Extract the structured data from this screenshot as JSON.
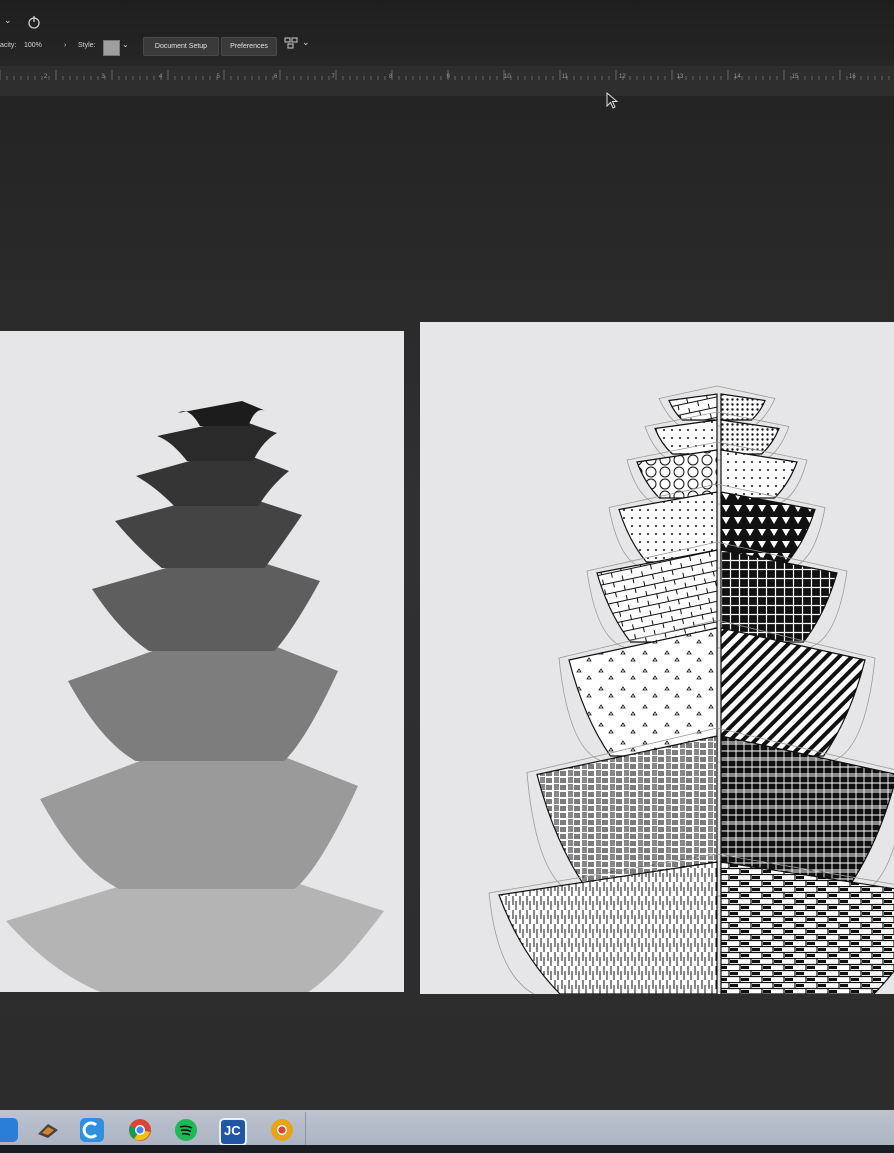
{
  "control_bar": {
    "opacity_label": "acity:",
    "opacity_value": "100%",
    "style_label": "Style:",
    "document_setup_label": "Document Setup",
    "preferences_label": "Preferences"
  },
  "ruler": {
    "labels": [
      "2",
      "3",
      "4",
      "5",
      "6",
      "7",
      "8",
      "9",
      "10",
      "11",
      "12",
      "13",
      "14",
      "15",
      "16"
    ]
  },
  "artboards": {
    "left": {
      "tier_count": 8,
      "fill": "grayscale-gradient"
    },
    "right": {
      "tier_count": 8,
      "fill": "patterns"
    }
  },
  "taskbar": {
    "apps": [
      "start-icon",
      "illustrator-pen-icon",
      "c-app-icon",
      "chrome-icon",
      "spotify-icon",
      "jc-app-icon",
      "chrome-canary-icon"
    ]
  },
  "colors": {
    "workspace": "#2b2b2b",
    "artboard": "#e6e6e8",
    "taskbar": "#b3bac7"
  }
}
